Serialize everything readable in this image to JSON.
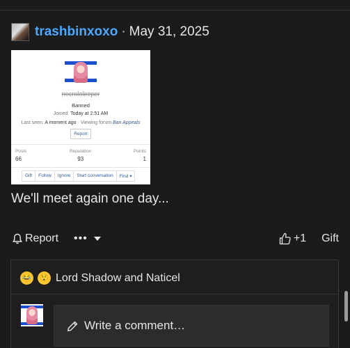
{
  "post": {
    "username": "trashbinxoxo",
    "separator": "·",
    "date": "May 31, 2025",
    "message": "We'll meet again one day..."
  },
  "embed": {
    "profile_name": "necrololireper",
    "status": "Banned",
    "joined_label": "Joined:",
    "joined_value": "Today at 2:51 AM",
    "last_seen_label": "Last seen:",
    "last_seen_value": "A moment ago",
    "last_seen_sep": "·",
    "viewing_text": "Viewing forum",
    "viewing_link": "Ban Appeals",
    "report_label": "Report",
    "stats": [
      {
        "label": "Posts",
        "value": "66"
      },
      {
        "label": "Reputation",
        "value": "93"
      },
      {
        "label": "Points",
        "value": "1"
      }
    ],
    "buttons": [
      "Gift",
      "Follow",
      "Ignore",
      "Start conversation",
      "Find ▾"
    ]
  },
  "actions": {
    "report_label": "Report",
    "more_label": "•••",
    "like_count": "+1",
    "gift_label": "Gift"
  },
  "reactions": {
    "text": "Lord Shadow and Naticel",
    "emojis": [
      "crying-laughing-icon",
      "astonished-icon"
    ]
  },
  "comment": {
    "placeholder": "Write a comment…"
  },
  "colors": {
    "background": "#1b1b1b",
    "username": "#4aa8ff",
    "link": "#2c5aa0"
  }
}
